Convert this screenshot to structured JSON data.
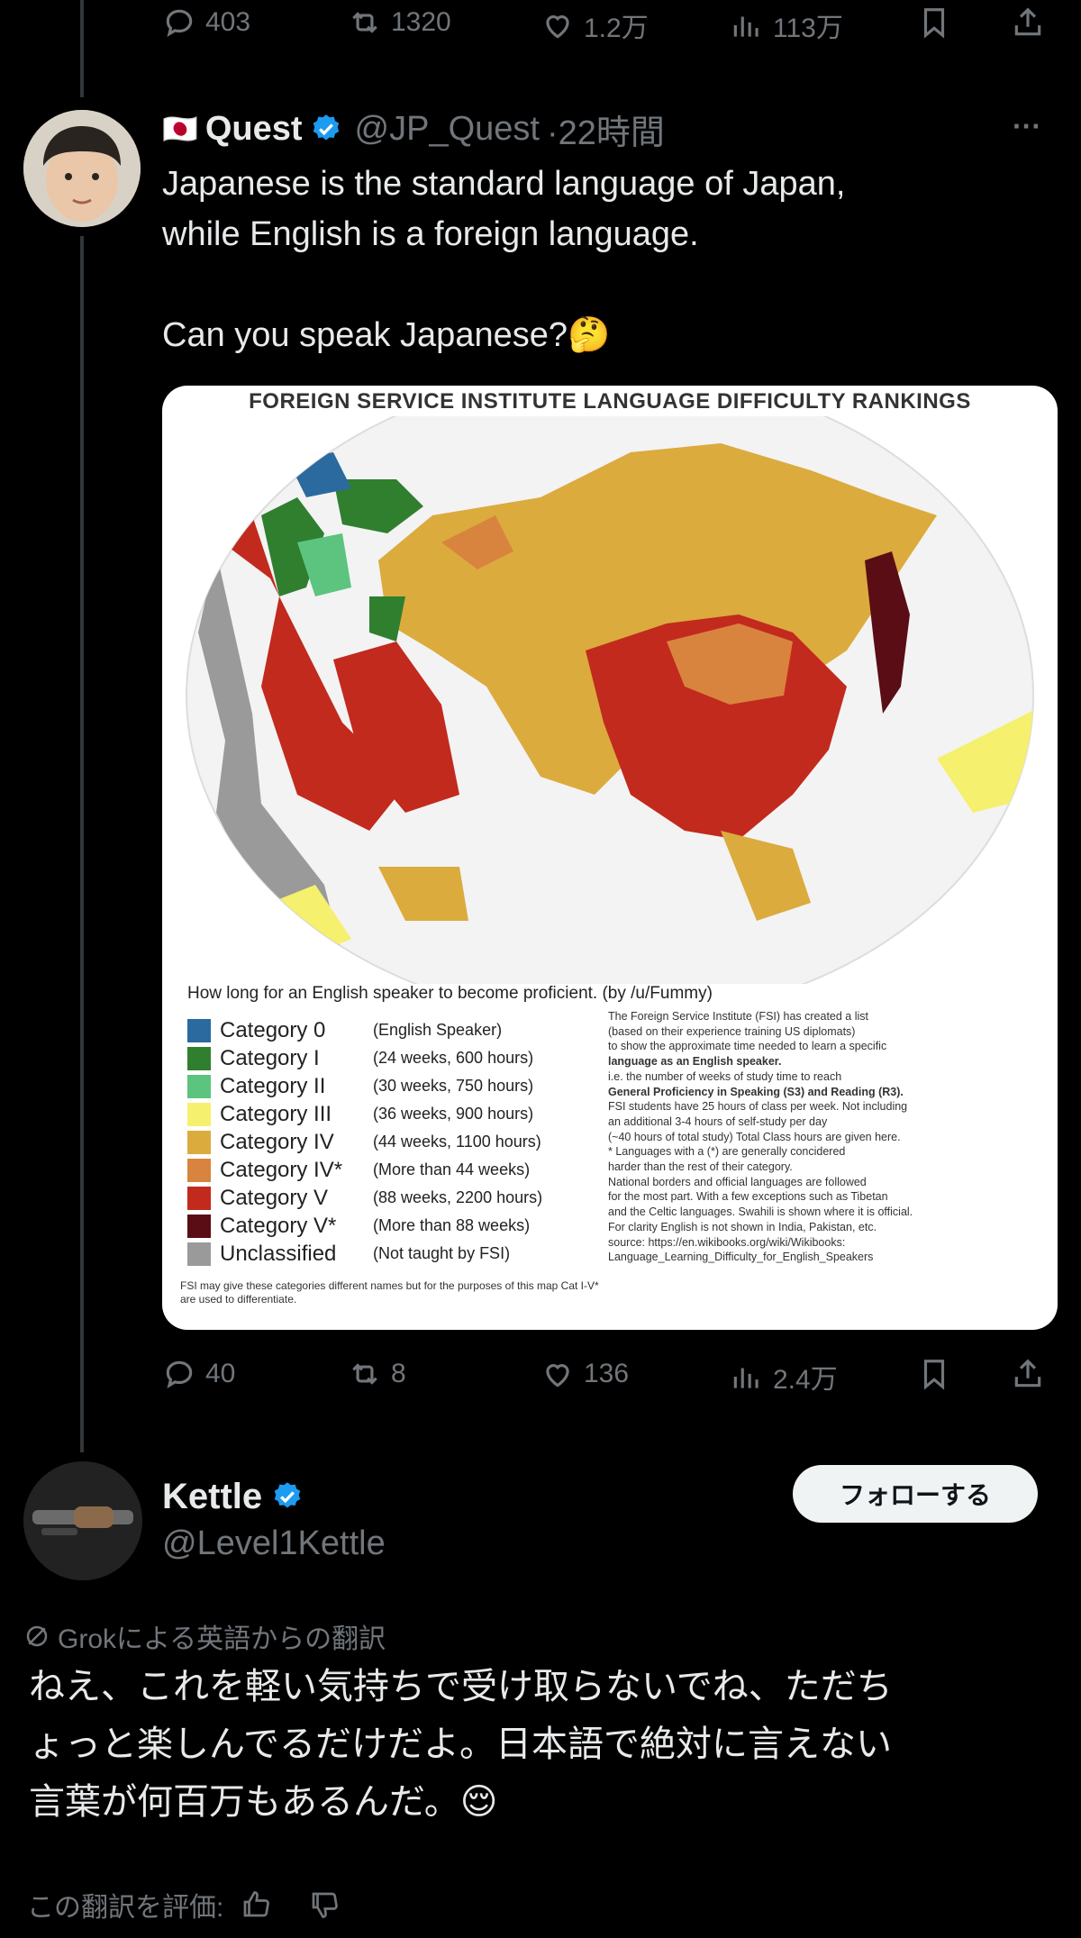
{
  "top_actions": {
    "replies": "403",
    "reposts": "1320",
    "likes": "1.2万",
    "views": "113万"
  },
  "tweet": {
    "flag": "🇯🇵",
    "display_name": "Quest",
    "handle": "@JP_Quest",
    "time": "·22時間",
    "more": "···",
    "text_line1": "Japanese is the standard language of Japan,",
    "text_line2": "while English is a foreign language.",
    "text_line3": "Can you speak Japanese?🤔",
    "actions": {
      "replies": "40",
      "reposts": "8",
      "likes": "136",
      "views": "2.4万"
    }
  },
  "map": {
    "title": "FOREIGN SERVICE INSTITUTE LANGUAGE DIFFICULTY RANKINGS",
    "legend_heading": "How long for an English speaker to become proficient. (by /u/Fummy)",
    "legend": [
      {
        "cat": "Category 0",
        "desc": "(English Speaker)",
        "color": "#2b6a9e"
      },
      {
        "cat": "Category I",
        "desc": "(24 weeks, 600 hours)",
        "color": "#2f7f2f"
      },
      {
        "cat": "Category II",
        "desc": "(30 weeks, 750 hours)",
        "color": "#5cc47e"
      },
      {
        "cat": "Category III",
        "desc": "(36 weeks, 900 hours)",
        "color": "#f5f06e"
      },
      {
        "cat": "Category IV",
        "desc": "(44 weeks, 1100 hours)",
        "color": "#dbab3e"
      },
      {
        "cat": "Category IV*",
        "desc": "(More than 44 weeks)",
        "color": "#d9843e"
      },
      {
        "cat": "Category V",
        "desc": "(88 weeks, 2200 hours)",
        "color": "#c22a1e"
      },
      {
        "cat": "Category V*",
        "desc": "(More than 88 weeks)",
        "color": "#5a0d14"
      },
      {
        "cat": "Unclassified",
        "desc": "(Not taught by FSI)",
        "color": "#9a9a9a"
      }
    ],
    "note": "FSI may give these categories different names but for the purposes of this map Cat I-V* are used to differentiate.",
    "info": [
      "The Foreign Service Institute (FSI) has created a list",
      "(based on their experience training US diplomats)",
      "to show the approximate time needed to learn a specific",
      "language as an English speaker.",
      "i.e. the number of weeks of study time to reach",
      "General Proficiency in Speaking (S3) and Reading (R3).",
      "FSI students have 25 hours of class per week. Not including",
      "an additional 3-4 hours of self-study per day",
      "(~40 hours of total study) Total Class hours are given here.",
      "* Languages with a (*) are generally concidered",
      "harder than the rest of their category.",
      "National borders and official languages are followed",
      "for the most part. With a few exceptions such as Tibetan",
      "and the Celtic languages. Swahili is shown where it is official.",
      "For clarity English is not shown in India, Pakistan, etc.",
      "source: https://en.wikibooks.org/wiki/Wikibooks:",
      "Language_Learning_Difficulty_for_English_Speakers"
    ]
  },
  "reply": {
    "display_name": "Kettle",
    "handle": "@Level1Kettle",
    "follow_label": "フォローする",
    "grok_label": "Grokによる英語からの翻訳",
    "translation_line1": "ねえ、これを軽い気持ちで受け取らないでね、ただち",
    "translation_line2": "ょっと楽しんでるだけだよ。日本語で絶対に言えない",
    "translation_line3": "言葉が何百万もあるんだ。😌",
    "rate_label": "この翻訳を評価:"
  },
  "colors": {
    "accent": "#1d9bf0",
    "muted": "#71767b",
    "background": "#000000"
  }
}
